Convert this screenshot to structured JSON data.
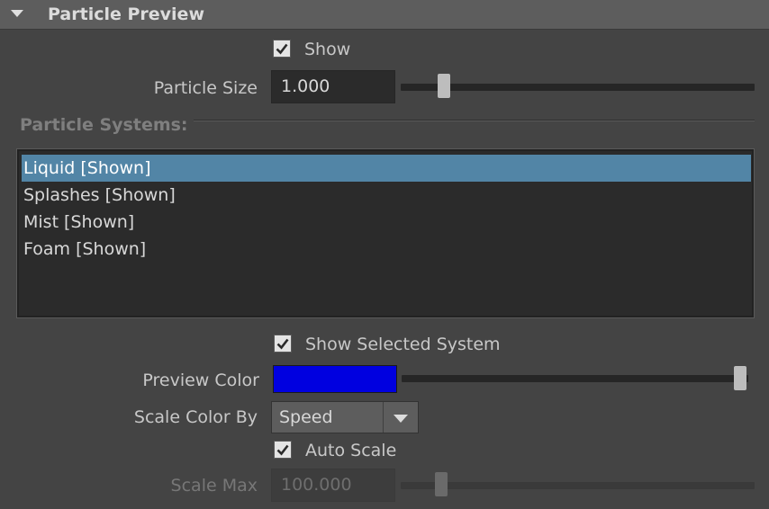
{
  "header": {
    "title": "Particle Preview"
  },
  "show": {
    "label": "Show",
    "checked": true
  },
  "particle_size": {
    "label": "Particle Size",
    "value": "1.000",
    "slider_fraction": 0.1
  },
  "particle_systems": {
    "label": "Particle Systems:",
    "items": [
      {
        "label": "Liquid [Shown]",
        "selected": true
      },
      {
        "label": "Splashes [Shown]",
        "selected": false
      },
      {
        "label": "Mist [Shown]",
        "selected": false
      },
      {
        "label": "Foam [Shown]",
        "selected": false
      }
    ]
  },
  "show_selected_system": {
    "label": "Show Selected System",
    "checked": true
  },
  "preview_color": {
    "label": "Preview Color",
    "color": "#0000e0",
    "slider_fraction": 1.0
  },
  "scale_color_by": {
    "label": "Scale Color By",
    "value": "Speed"
  },
  "auto_scale": {
    "label": "Auto Scale",
    "checked": true
  },
  "scale_max": {
    "label": "Scale Max",
    "value": "100.000",
    "slider_fraction": 0.1,
    "enabled": false
  }
}
